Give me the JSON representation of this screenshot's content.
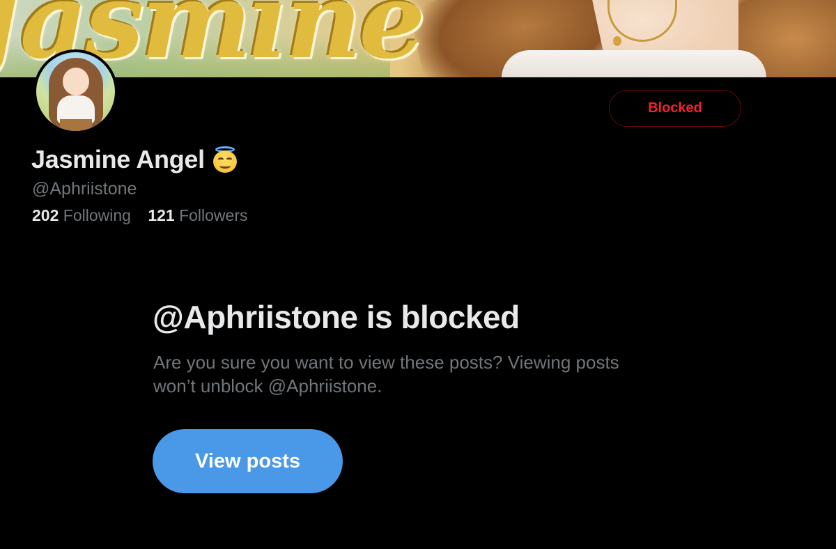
{
  "banner": {
    "script_text": "Jasmine"
  },
  "profile": {
    "display_name": "Jasmine Angel",
    "name_emoji": "smiling-face-with-halo",
    "handle": "@Aphriistone",
    "following_count": "202",
    "following_label": "Following",
    "followers_count": "121",
    "followers_label": "Followers"
  },
  "actions": {
    "blocked_label": "Blocked"
  },
  "blocked_notice": {
    "title": "@Aphriistone is blocked",
    "description": "Are you sure you want to view these posts? Viewing posts won’t unblock @Aphriistone.",
    "view_posts_label": "View posts"
  },
  "colors": {
    "background": "#000000",
    "primary_text": "#e7e9ea",
    "secondary_text": "#71767b",
    "blocked_red": "#f4212e",
    "accent_blue": "#4a99e9"
  }
}
